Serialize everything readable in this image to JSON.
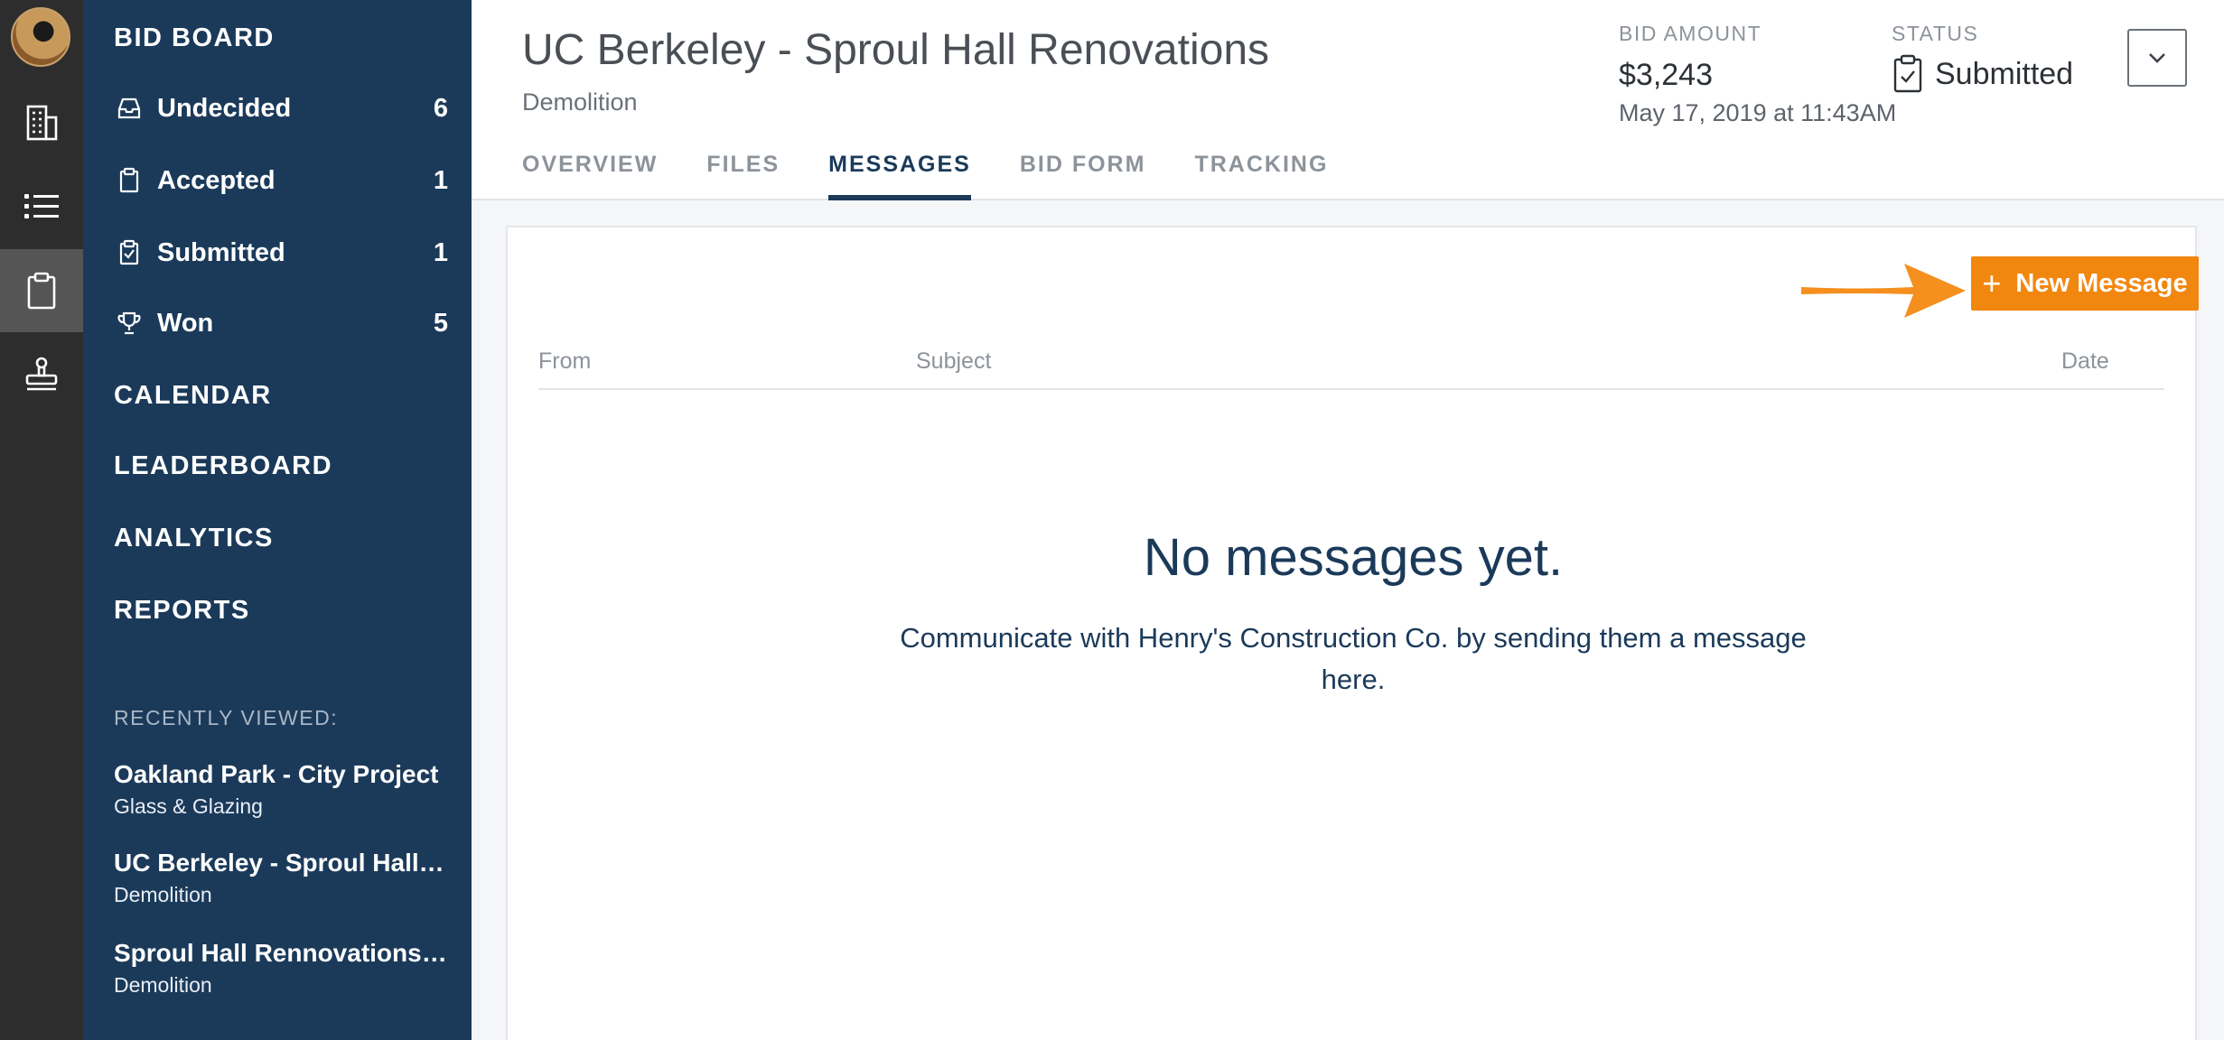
{
  "rail": {
    "icons": [
      "avatar",
      "building-icon",
      "list-icon",
      "clipboard-icon",
      "stamp-icon"
    ],
    "active": "clipboard-icon"
  },
  "nav": {
    "bid_board": "BID BOARD",
    "items": [
      {
        "label": "Undecided",
        "count": "6",
        "icon": "inbox-icon"
      },
      {
        "label": "Accepted",
        "count": "1",
        "icon": "clipboard-icon"
      },
      {
        "label": "Submitted",
        "count": "1",
        "icon": "clipboard-check-icon"
      },
      {
        "label": "Won",
        "count": "5",
        "icon": "trophy-icon"
      }
    ],
    "calendar": "CALENDAR",
    "leaderboard": "LEADERBOARD",
    "analytics": "ANALYTICS",
    "reports": "REPORTS",
    "recently_viewed": "RECENTLY VIEWED:",
    "recent": [
      {
        "title": "Oakland Park - City Project",
        "sub": "Glass & Glazing"
      },
      {
        "title": "UC Berkeley - Sproul Hall R...",
        "sub": "Demolition"
      },
      {
        "title": "Sproul Hall Rennovations - ...",
        "sub": "Demolition"
      }
    ]
  },
  "header": {
    "title": "UC Berkeley - Sproul Hall Renovations",
    "subtitle": "Demolition",
    "bid_amount_label": "BID AMOUNT",
    "bid_amount": "$3,243",
    "bid_date": "May 17, 2019 at 11:43AM",
    "status_label": "STATUS",
    "status": "Submitted",
    "tabs": [
      {
        "label": "OVERVIEW",
        "active": false
      },
      {
        "label": "FILES",
        "active": false
      },
      {
        "label": "MESSAGES",
        "active": true
      },
      {
        "label": "BID FORM",
        "active": false
      },
      {
        "label": "TRACKING",
        "active": false
      }
    ]
  },
  "messages": {
    "new_button": "New Message",
    "new_button_icon": "+",
    "columns": {
      "from": "From",
      "subject": "Subject",
      "date": "Date"
    },
    "empty_title": "No messages yet.",
    "empty_desc": "Communicate with Henry's Construction Co. by sending them a message here."
  },
  "colors": {
    "rail_bg": "#2d2d2d",
    "nav_bg": "#1b3a5a",
    "accent": "#f2870f",
    "active_tab": "#1b3a5a"
  }
}
